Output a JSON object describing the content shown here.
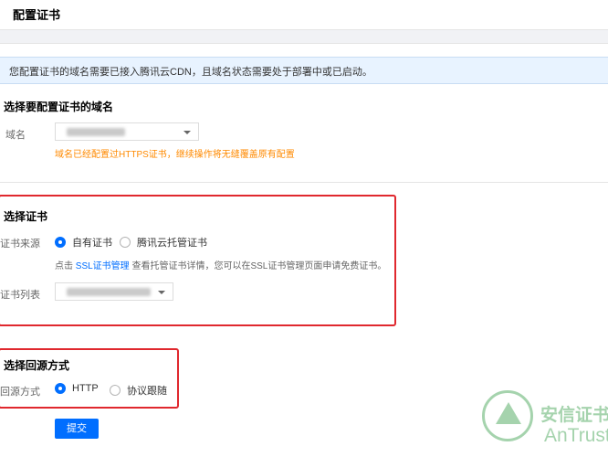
{
  "page": {
    "title": "配置证书"
  },
  "notice": {
    "text": "您配置证书的域名需要已接入腾讯云CDN，且域名状态需要处于部署中或已启动。"
  },
  "domain_section": {
    "title": "选择要配置证书的域名",
    "field_label": "域名",
    "warning": "域名已经配置过HTTPS证书，继续操作将无缝覆盖原有配置"
  },
  "cert_section": {
    "title": "选择证书",
    "source_label": "证书来源",
    "source_options": [
      {
        "label": "自有证书",
        "selected": true
      },
      {
        "label": "腾讯云托管证书",
        "selected": false
      }
    ],
    "hint_prefix": "点击",
    "hint_link": "SSL证书管理",
    "hint_suffix": "查看托管证书详情，您可以在SSL证书管理页面申请免费证书。",
    "list_label": "证书列表"
  },
  "origin_section": {
    "title": "选择回源方式",
    "field_label": "回源方式",
    "options": [
      {
        "label": "HTTP",
        "selected": true
      },
      {
        "label": "协议跟随",
        "selected": false
      }
    ]
  },
  "submit_button": {
    "label": "提交"
  },
  "watermark": {
    "cn": "安信证书",
    "en": "AnTrust"
  },
  "colors": {
    "accent": "#006eff",
    "warning": "#ff8a00",
    "highlight_border": "#e0282e"
  },
  "icons": {
    "dropdown": "chevron-down-icon",
    "radio_on": "radio-checked-icon",
    "radio_off": "radio-unchecked-icon"
  }
}
